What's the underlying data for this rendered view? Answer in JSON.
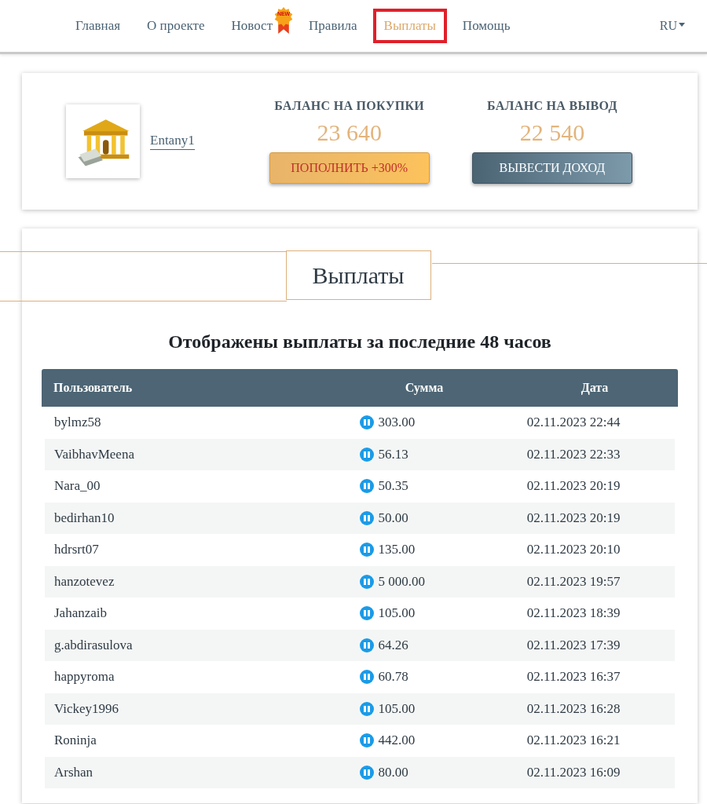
{
  "nav": {
    "items": [
      {
        "label": "Главная",
        "selected": false
      },
      {
        "label": "О проекте",
        "selected": false
      },
      {
        "label": "Новост",
        "selected": false,
        "badge": "NEW"
      },
      {
        "label": "Правила",
        "selected": false
      },
      {
        "label": "Выплаты",
        "selected": true
      },
      {
        "label": "Помощь",
        "selected": false
      }
    ],
    "language": "RU"
  },
  "account": {
    "username": "Entany1",
    "balances": [
      {
        "title": "БАЛАНС НА ПОКУПКИ",
        "amount": "23 640",
        "button": "ПОПОЛНИТЬ +300%",
        "kind": "deposit"
      },
      {
        "title": "БАЛАНС НА ВЫВОД",
        "amount": "22 540",
        "button": "ВЫВЕСТИ ДОХОД",
        "kind": "withdraw"
      }
    ]
  },
  "payouts": {
    "title": "Выплаты",
    "subtitle": "Отображены выплаты за последние 48 часов",
    "table": {
      "columns": [
        "Пользователь",
        "Сумма",
        "Дата"
      ],
      "rows": [
        [
          "bylmz58",
          "303.00",
          "02.11.2023 22:44"
        ],
        [
          "VaibhavMeena",
          "56.13",
          "02.11.2023 22:33"
        ],
        [
          "Nara_00",
          "50.35",
          "02.11.2023 20:19"
        ],
        [
          "bedirhan10",
          "50.00",
          "02.11.2023 20:19"
        ],
        [
          "hdrsrt07",
          "135.00",
          "02.11.2023 20:10"
        ],
        [
          "hanzotevez",
          "5 000.00",
          "02.11.2023 19:57"
        ],
        [
          "Jahanzaib",
          "105.00",
          "02.11.2023 18:39"
        ],
        [
          "g.abdirasulova",
          "64.26",
          "02.11.2023 17:39"
        ],
        [
          "happyroma",
          "60.78",
          "02.11.2023 16:37"
        ],
        [
          "Vickey1996",
          "105.00",
          "02.11.2023 16:28"
        ],
        [
          "Roninja",
          "442.00",
          "02.11.2023 16:21"
        ],
        [
          "Arshan",
          "80.00",
          "02.11.2023 16:09"
        ]
      ]
    }
  }
}
